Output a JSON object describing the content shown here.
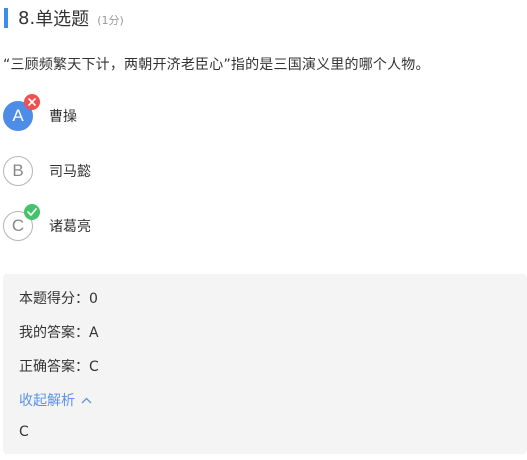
{
  "question": {
    "number": "8.",
    "type": "单选题",
    "score": "(1分)",
    "stem": "“三顾频繁天下计，两朝开济老臣心”指的是三国演义里的哪个人物。",
    "options": [
      {
        "letter": "A",
        "text": "曹操",
        "selected": true,
        "status": "wrong"
      },
      {
        "letter": "B",
        "text": "司马懿",
        "selected": false,
        "status": "none"
      },
      {
        "letter": "C",
        "text": "诸葛亮",
        "selected": false,
        "status": "correct"
      }
    ]
  },
  "result": {
    "score_label": "本题得分：",
    "score_value": "0",
    "my_answer_label": "我的答案：",
    "my_answer_value": "A",
    "correct_answer_label": "正确答案：",
    "correct_answer_value": "C",
    "toggle_label": "收起解析",
    "analysis": "C"
  },
  "colors": {
    "accent": "#3a8ee6",
    "selected_option": "#4d8de7",
    "wrong": "#f0504e",
    "correct": "#45c26b",
    "link": "#5b93e8",
    "panel_bg": "#f4f4f5"
  }
}
